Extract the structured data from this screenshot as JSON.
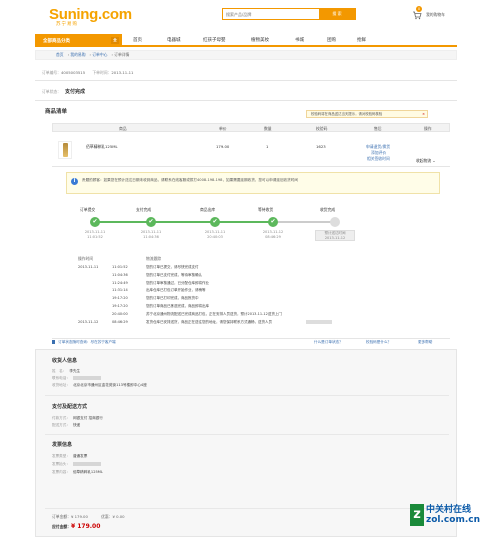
{
  "header": {
    "logo_main": "Suning.com",
    "logo_sub": "苏宁易购",
    "search_placeholder": "搜索产品/品牌",
    "search_button": "搜 索",
    "cart_label": "我的购物车",
    "cart_count": "0"
  },
  "nav": {
    "category_label": "全部商品分类",
    "category_icon": "全",
    "items": [
      "首页",
      "电器城",
      "红孩子母婴",
      "植物美妆",
      "书城",
      "团购",
      "抢鲜"
    ]
  },
  "breadcrumb": [
    "首页",
    "我的易购",
    "订单中心",
    "订单详情"
  ],
  "order": {
    "number_label": "订单编号：",
    "number": "4005003515",
    "time_label": "下单时间：",
    "time": "2013-11-11",
    "status_label": "订单状态：",
    "status": "支付完成"
  },
  "goods": {
    "title": "商品清单",
    "tip": "校验码将在商品送达当天提示，请对校验码核验",
    "tip_close": "×",
    "headers": [
      "商品",
      "单价",
      "数量",
      "校验码",
      "售后",
      "操作"
    ],
    "product_name": "佰草精粹乳125ML",
    "price": "179.00",
    "qty": "1",
    "code": "1623",
    "aftersale": [
      "申请退货/换货",
      "添加评价",
      "相关签收时间"
    ],
    "fold": "收起物流 ⌄"
  },
  "notice": {
    "icon": "i",
    "text": "贵题的顾客：如果您在预计送达日期未收到商品，请联系在线客服或拨打4008-198-198，如果需要延期收货，您可以申请延迟收货时间"
  },
  "progress": {
    "steps": [
      {
        "label": "订单提交",
        "date": "2013-11-11",
        "time": "11:01:52",
        "done": true
      },
      {
        "label": "支付完成",
        "date": "2013-11-11",
        "time": "11:04:36",
        "done": true
      },
      {
        "label": "商品出库",
        "date": "2013-11-11",
        "time": "20:40:03",
        "done": true
      },
      {
        "label": "等待收货",
        "date": "2013-11-12",
        "time": "08:46:29",
        "done": true
      },
      {
        "label": "收货完成",
        "date": "预计送达时间",
        "time": "2013-11-12",
        "done": false
      }
    ],
    "check": "✔"
  },
  "log": {
    "head_time": "操作时间",
    "head_desc": "物流跟踪",
    "rows": [
      {
        "date": "2013-11-11",
        "time": "11:01:52",
        "desc": "您的订单已提交，请尽快完成支付"
      },
      {
        "date": "",
        "time": "11:04:36",
        "desc": "您的订单已支付完成，等待审核确认"
      },
      {
        "date": "",
        "time": "11:24:49",
        "desc": "您的订单审核通过，已分配仓库即将作业"
      },
      {
        "date": "",
        "time": "11:31:14",
        "desc": "出库仓库已打包订单开始作业，请稍等"
      },
      {
        "date": "",
        "time": "19:17:20",
        "desc": "您的订单已打印完成，商品拣货中"
      },
      {
        "date": "",
        "time": "19:17:20",
        "desc": "您的订单商品已拣选完成，商品即将出库"
      },
      {
        "date": "",
        "time": "20:40:00",
        "desc": "苏宁北京通州物流配送已完成商品打包，正在安排人员送货，预计2013-11-12送货上门"
      },
      {
        "date": "2013-11-12",
        "time": "08:46:29",
        "desc": "发货仓库已安排送货，商品正在送往您的地址，请您保持联系方式通畅，送货人员"
      }
    ]
  },
  "tools": {
    "left": "订单状态随时查询：尽在苏宁客户端",
    "q1": "什么是订单状态？",
    "q2": "校验码是什么？",
    "more": "更多帮助"
  },
  "receiver": {
    "title": "收货人信息",
    "name_label": "姓　名：",
    "name": "李先生",
    "phone_label": "联系电话：",
    "addr_label": "收货地址：",
    "addr": "北京北京市通州区金花苑街113号楼即中心4座"
  },
  "payment": {
    "title": "支付及配送方式",
    "pay_label": "付款方式：",
    "pay": "网银支付 招商银行",
    "ship_label": "配送方式：",
    "ship": "快递"
  },
  "invoice": {
    "title": "发票信息",
    "type_label": "发票类型：",
    "type": "普通发票",
    "head_label": "发票抬头：",
    "content_label": "发票内容：",
    "content": "佰草精粹乳125ML"
  },
  "totals": {
    "amount_label": "订单金额：",
    "amount": "¥ 179.00",
    "discount_label": "优惠：",
    "discount": "¥ 0.00",
    "pay_label": "应付金额：",
    "pay": "¥ 179.00"
  },
  "watermark": {
    "z": "z",
    "line1": "中关村在线",
    "line2": "zol.com.cn"
  }
}
